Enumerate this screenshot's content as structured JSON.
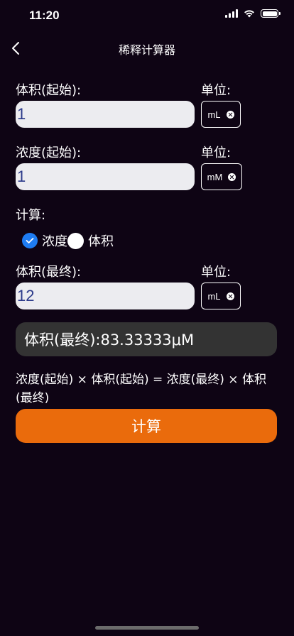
{
  "status_bar": {
    "time": "11:20"
  },
  "nav": {
    "title": "稀释计算器"
  },
  "initial_volume": {
    "label": "体积(起始):",
    "value": "1",
    "unit_label": "单位:",
    "unit": "mL"
  },
  "initial_concentration": {
    "label": "浓度(起始):",
    "value": "1",
    "unit_label": "单位:",
    "unit": "mM"
  },
  "compute_mode": {
    "label": "计算:",
    "options": [
      {
        "label": "浓度",
        "selected": true
      },
      {
        "label": "体积",
        "selected": false
      }
    ]
  },
  "final_volume": {
    "label": "体积(最终):",
    "value": "12",
    "unit_label": "单位:",
    "unit": "mL"
  },
  "result": {
    "text": "体积(最终):83.33333μM"
  },
  "formula": "浓度(起始) × 体积(起始) = 浓度(最终) × 体积(最终)",
  "compute_button": {
    "label": "计算"
  },
  "colors": {
    "background": "#0e0414",
    "accent_blue": "#1e7cf2",
    "button_orange": "#ea6b0c",
    "input_bg": "#ececf0",
    "result_bg": "#333333"
  }
}
